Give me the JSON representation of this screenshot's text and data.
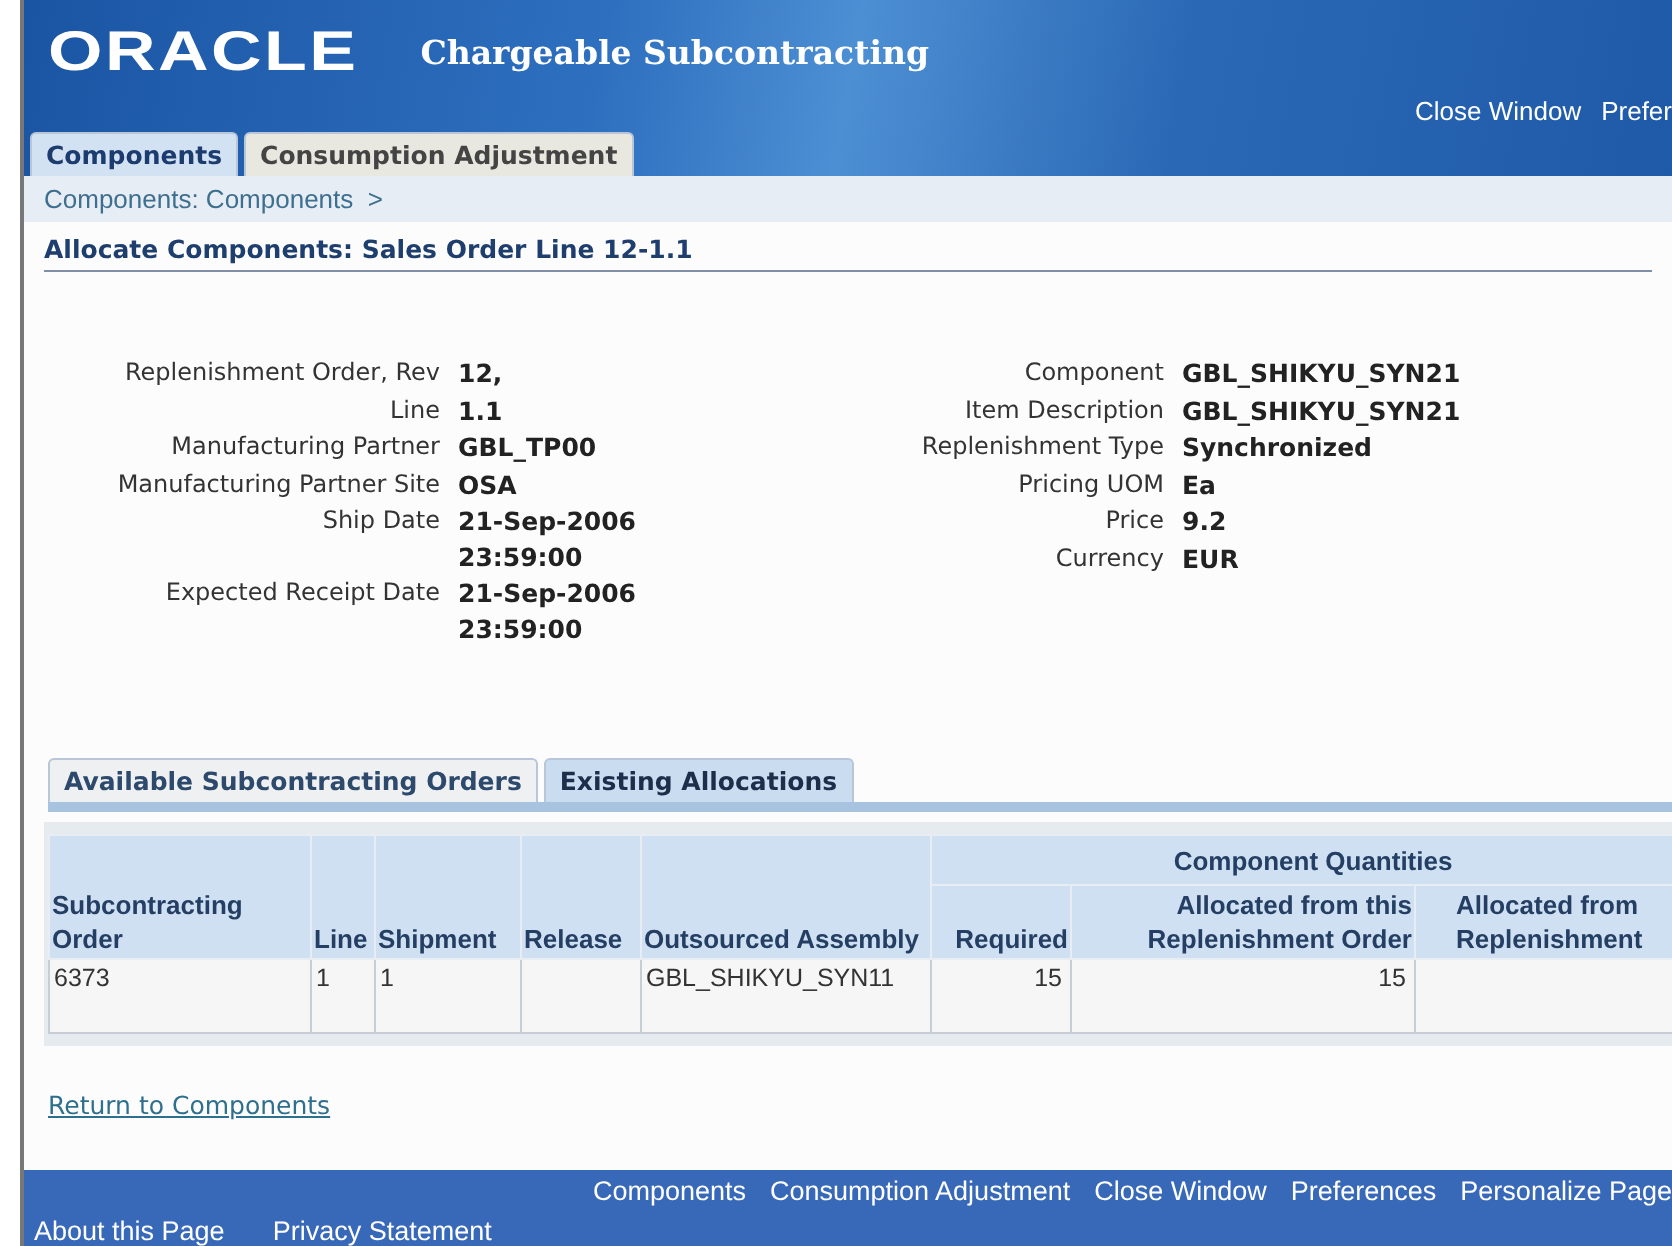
{
  "header": {
    "logo": "ORACLE",
    "app_title": "Chargeable Subcontracting",
    "global_links": [
      "Close Window",
      "Prefer"
    ]
  },
  "tabs": [
    {
      "label": "Components",
      "selected": true
    },
    {
      "label": "Consumption Adjustment",
      "selected": false
    }
  ],
  "breadcrumb": "Components: Components  >",
  "page_title": "Allocate Components: Sales Order Line 12-1.1",
  "details_left": [
    {
      "label": "Replenishment Order, Rev",
      "value": [
        "12,"
      ]
    },
    {
      "label": "Line",
      "value": [
        "1.1"
      ]
    },
    {
      "label": "Manufacturing Partner",
      "value": [
        "GBL_TP00"
      ]
    },
    {
      "label": "Manufacturing Partner Site",
      "value": [
        "OSA"
      ]
    },
    {
      "label": "Ship Date",
      "value": [
        "21-Sep-2006",
        "23:59:00"
      ]
    },
    {
      "label": "Expected Receipt Date",
      "value": [
        "21-Sep-2006",
        "23:59:00"
      ]
    }
  ],
  "details_right": [
    {
      "label": "Component",
      "value": [
        "GBL_SHIKYU_SYN21"
      ]
    },
    {
      "label": "Item Description",
      "value": [
        "GBL_SHIKYU_SYN21"
      ]
    },
    {
      "label": "Replenishment Type",
      "value": [
        "Synchronized"
      ]
    },
    {
      "label": "Pricing UOM",
      "value": [
        "Ea"
      ]
    },
    {
      "label": "Price",
      "value": [
        "9.2"
      ]
    },
    {
      "label": "Currency",
      "value": [
        "EUR"
      ]
    }
  ],
  "subtabs": [
    {
      "label": "Available Subcontracting Orders",
      "selected": false
    },
    {
      "label": "Existing Allocations",
      "selected": true
    }
  ],
  "table": {
    "group_header": "Component Quantities",
    "columns": [
      "Subcontracting Order",
      "Line",
      "Shipment",
      "Release",
      "Outsourced Assembly",
      "Required",
      "Allocated from this Replenishment Order",
      "Allocated from Replenishment"
    ],
    "rows": [
      [
        "6373",
        "1",
        "1",
        "",
        "GBL_SHIKYU_SYN11",
        "15",
        "15",
        ""
      ]
    ]
  },
  "return_link": "Return to Components",
  "footer": {
    "links": [
      "Components",
      "Consumption Adjustment",
      "Close Window",
      "Preferences",
      "Personalize Page"
    ],
    "bottom_links": [
      "About this Page",
      "Privacy Statement"
    ]
  }
}
